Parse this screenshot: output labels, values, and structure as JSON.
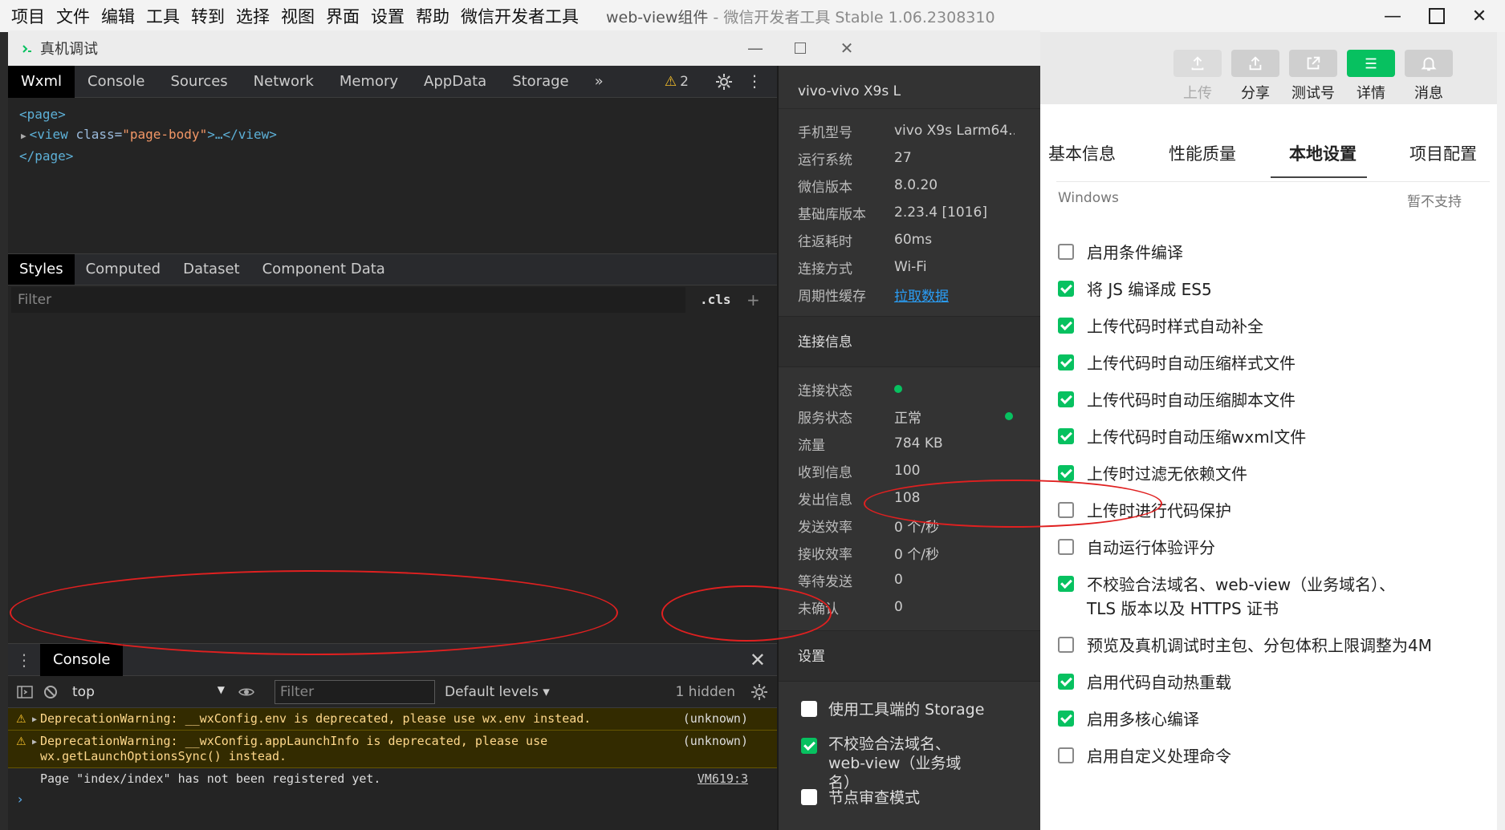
{
  "menubar": {
    "items": [
      "项目",
      "文件",
      "编辑",
      "工具",
      "转到",
      "选择",
      "视图",
      "界面",
      "设置",
      "帮助",
      "微信开发者工具"
    ],
    "title_project": "web-view组件",
    "title_suffix": " - 微信开发者工具 Stable 1.06.2308310"
  },
  "right_app": {
    "toolbar": [
      {
        "label": "上传",
        "icon": "upload-icon",
        "state": "disabled"
      },
      {
        "label": "分享",
        "icon": "share-icon",
        "state": "normal"
      },
      {
        "label": "测试号",
        "icon": "external-link-icon",
        "state": "normal"
      },
      {
        "label": "详情",
        "icon": "menu-lines-icon",
        "state": "active"
      },
      {
        "label": "消息",
        "icon": "bell-icon",
        "state": "normal"
      }
    ],
    "tabs": [
      "基本信息",
      "性能质量",
      "本地设置",
      "项目配置"
    ],
    "active_tab": "本地设置",
    "platform_label": "Windows",
    "platform_value": "暂不支持",
    "settings": [
      {
        "label": "启用条件编译",
        "checked": false
      },
      {
        "label": "将 JS 编译成 ES5",
        "checked": true
      },
      {
        "label": "上传代码时样式自动补全",
        "checked": true
      },
      {
        "label": "上传代码时自动压缩样式文件",
        "checked": true
      },
      {
        "label": "上传代码时自动压缩脚本文件",
        "checked": true
      },
      {
        "label": "上传代码时自动压缩wxml文件",
        "checked": true
      },
      {
        "label": "上传时过滤无依赖文件",
        "checked": true
      },
      {
        "label": "上传时进行代码保护",
        "checked": false
      },
      {
        "label": "自动运行体验评分",
        "checked": false
      },
      {
        "label": "不校验合法域名、web-view（业务域名）、TLS 版本以及 HTTPS 证书",
        "checked": true
      },
      {
        "label": "预览及真机调试时主包、分包体积上限调整为4M",
        "checked": false
      },
      {
        "label": "启用代码自动热重载",
        "checked": true
      },
      {
        "label": "启用多核心编译",
        "checked": true
      },
      {
        "label": "启用自定义处理命令",
        "checked": false
      }
    ]
  },
  "devwin": {
    "title": "真机调试",
    "tabs": [
      "Wxml",
      "Console",
      "Sources",
      "Network",
      "Memory",
      "AppData",
      "Storage"
    ],
    "more_tabs": "»",
    "warning_count": "2",
    "dom": {
      "line1": "<page>",
      "line2_open": "<view",
      "line2_attr": "class=",
      "line2_val": "\"page-body\"",
      "line2_close": ">…</view>",
      "line3": "</page>"
    },
    "style_tabs": [
      "Styles",
      "Computed",
      "Dataset",
      "Component Data"
    ],
    "styles_filter_placeholder": "Filter",
    "cls_label": ".cls",
    "plus_label": "+",
    "drawer": {
      "tab": "Console",
      "context": "top",
      "filter_placeholder": "Filter",
      "levels": "Default levels ▾",
      "hidden": "1 hidden",
      "messages": [
        {
          "type": "warn",
          "text": "DeprecationWarning: __wxConfig.env is deprecated, please use wx.env instead.",
          "source": "(unknown)"
        },
        {
          "type": "warn",
          "text": "DeprecationWarning: __wxConfig.appLaunchInfo is deprecated, please use wx.getLaunchOptionsSync() instead.",
          "source": "(unknown)"
        },
        {
          "type": "log",
          "text": "Page \"index/index\" has not been registered yet.",
          "source": "VM619:3"
        }
      ],
      "prompt": "›"
    }
  },
  "device": {
    "name": "vivo-vivo X9s L",
    "info": [
      {
        "k": "手机型号",
        "v": "vivo X9s Larm64..."
      },
      {
        "k": "运行系统",
        "v": "27"
      },
      {
        "k": "微信版本",
        "v": "8.0.20"
      },
      {
        "k": "基础库版本",
        "v": "2.23.4 [1016]"
      },
      {
        "k": "往返耗时",
        "v": "60ms"
      },
      {
        "k": "连接方式",
        "v": "Wi-Fi"
      },
      {
        "k": "周期性缓存",
        "v": "拉取数据"
      }
    ],
    "conn_title": "连接信息",
    "conn": [
      {
        "k": "连接状态",
        "v": ""
      },
      {
        "k": "服务状态",
        "v": "正常"
      },
      {
        "k": "流量",
        "v": "784 KB"
      },
      {
        "k": "收到信息",
        "v": "100"
      },
      {
        "k": "发出信息",
        "v": "108"
      },
      {
        "k": "发送效率",
        "v": "0 个/秒"
      },
      {
        "k": "接收效率",
        "v": "0 个/秒"
      },
      {
        "k": "等待发送",
        "v": "0"
      },
      {
        "k": "未确认",
        "v": "0"
      }
    ],
    "settings_title": "设置",
    "settings": [
      {
        "label": "使用工具端的 Storage",
        "checked": false
      },
      {
        "label": "不校验合法域名、web-view（业务域名）",
        "checked": true
      },
      {
        "label": "节点审查模式",
        "checked": false
      }
    ],
    "accent": "#07c160"
  }
}
